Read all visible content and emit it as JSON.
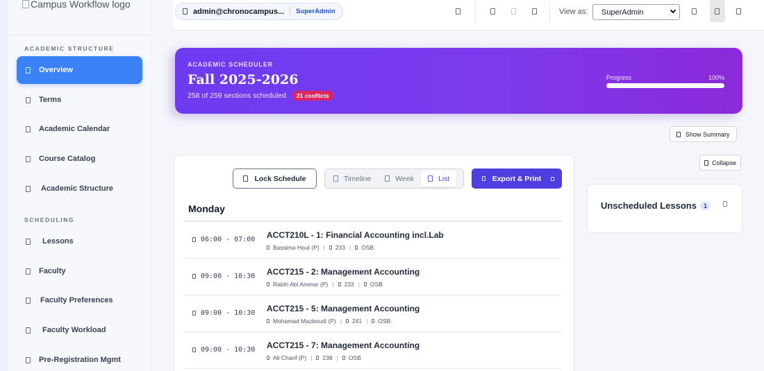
{
  "app": {
    "logo_alt": "Campus Workflow logo"
  },
  "sidebar": {
    "sections": [
      {
        "label": "ACADEMIC STRUCTURE"
      },
      {
        "label": "SCHEDULING"
      }
    ],
    "items": [
      {
        "label": "Overview",
        "icon": "home-icon",
        "active": true
      },
      {
        "label": "Terms",
        "icon": "calendar-icon"
      },
      {
        "label": "Academic Calendar",
        "icon": "calendar-icon"
      },
      {
        "label": "Course Catalog",
        "icon": "book-icon"
      },
      {
        "label": "Academic Structure",
        "icon": "building-icon"
      },
      {
        "label": "Lessons",
        "icon": "clock-icon"
      },
      {
        "label": "Faculty",
        "icon": "users-icon"
      },
      {
        "label": "Faculty Preferences",
        "icon": "sliders-icon"
      },
      {
        "label": "Faculty Workload",
        "icon": "chart-icon"
      },
      {
        "label": "Pre-Registration Mgmt",
        "icon": "clipboard-icon"
      }
    ]
  },
  "topbar": {
    "user_email": "admin@chronocampus...",
    "user_role": "SuperAdmin",
    "view_as_label": "View as:",
    "view_as_value": "SuperAdmin"
  },
  "header": {
    "eyebrow": "ACADEMIC SCHEDULER",
    "title": "Fall 2025-2026",
    "subtitle": "258 of 259 sections scheduled",
    "conflicts": "21 conflicts",
    "progress_label": "Progress",
    "progress_text": "100%",
    "progress": 1.0
  },
  "actions": {
    "show_summary": "Show Summary",
    "collapse": "Collapse"
  },
  "toolbar": {
    "lock_label": "Lock Schedule",
    "views": [
      {
        "label": "Timeline",
        "active": false
      },
      {
        "label": "Week",
        "active": false
      },
      {
        "label": "List",
        "active": true
      }
    ],
    "export_label": "Export & Print"
  },
  "schedule": {
    "day": "Monday",
    "rows": [
      {
        "time": "06:00 - 07:00",
        "course": "ACCT210L - 1: Financial Accounting incl.Lab",
        "faculty": "Bassima Hout (P)",
        "room": "233",
        "building": "OSB"
      },
      {
        "time": "09:00 - 10:30",
        "course": "ACCT215 - 2: Management Accounting",
        "faculty": "Rabih Abi Ammar (P)",
        "room": "233",
        "building": "OSB"
      },
      {
        "time": "09:00 - 10:30",
        "course": "ACCT215 - 5: Management Accounting",
        "faculty": "Mohamad Mazboudi (P)",
        "room": "241",
        "building": "OSB"
      },
      {
        "time": "09:00 - 10:30",
        "course": "ACCT215 - 7: Management Accounting",
        "faculty": "Ali Charif (P)",
        "room": "238",
        "building": "OSB"
      }
    ]
  },
  "unscheduled": {
    "title": "Unscheduled Lessons",
    "count": "1"
  }
}
